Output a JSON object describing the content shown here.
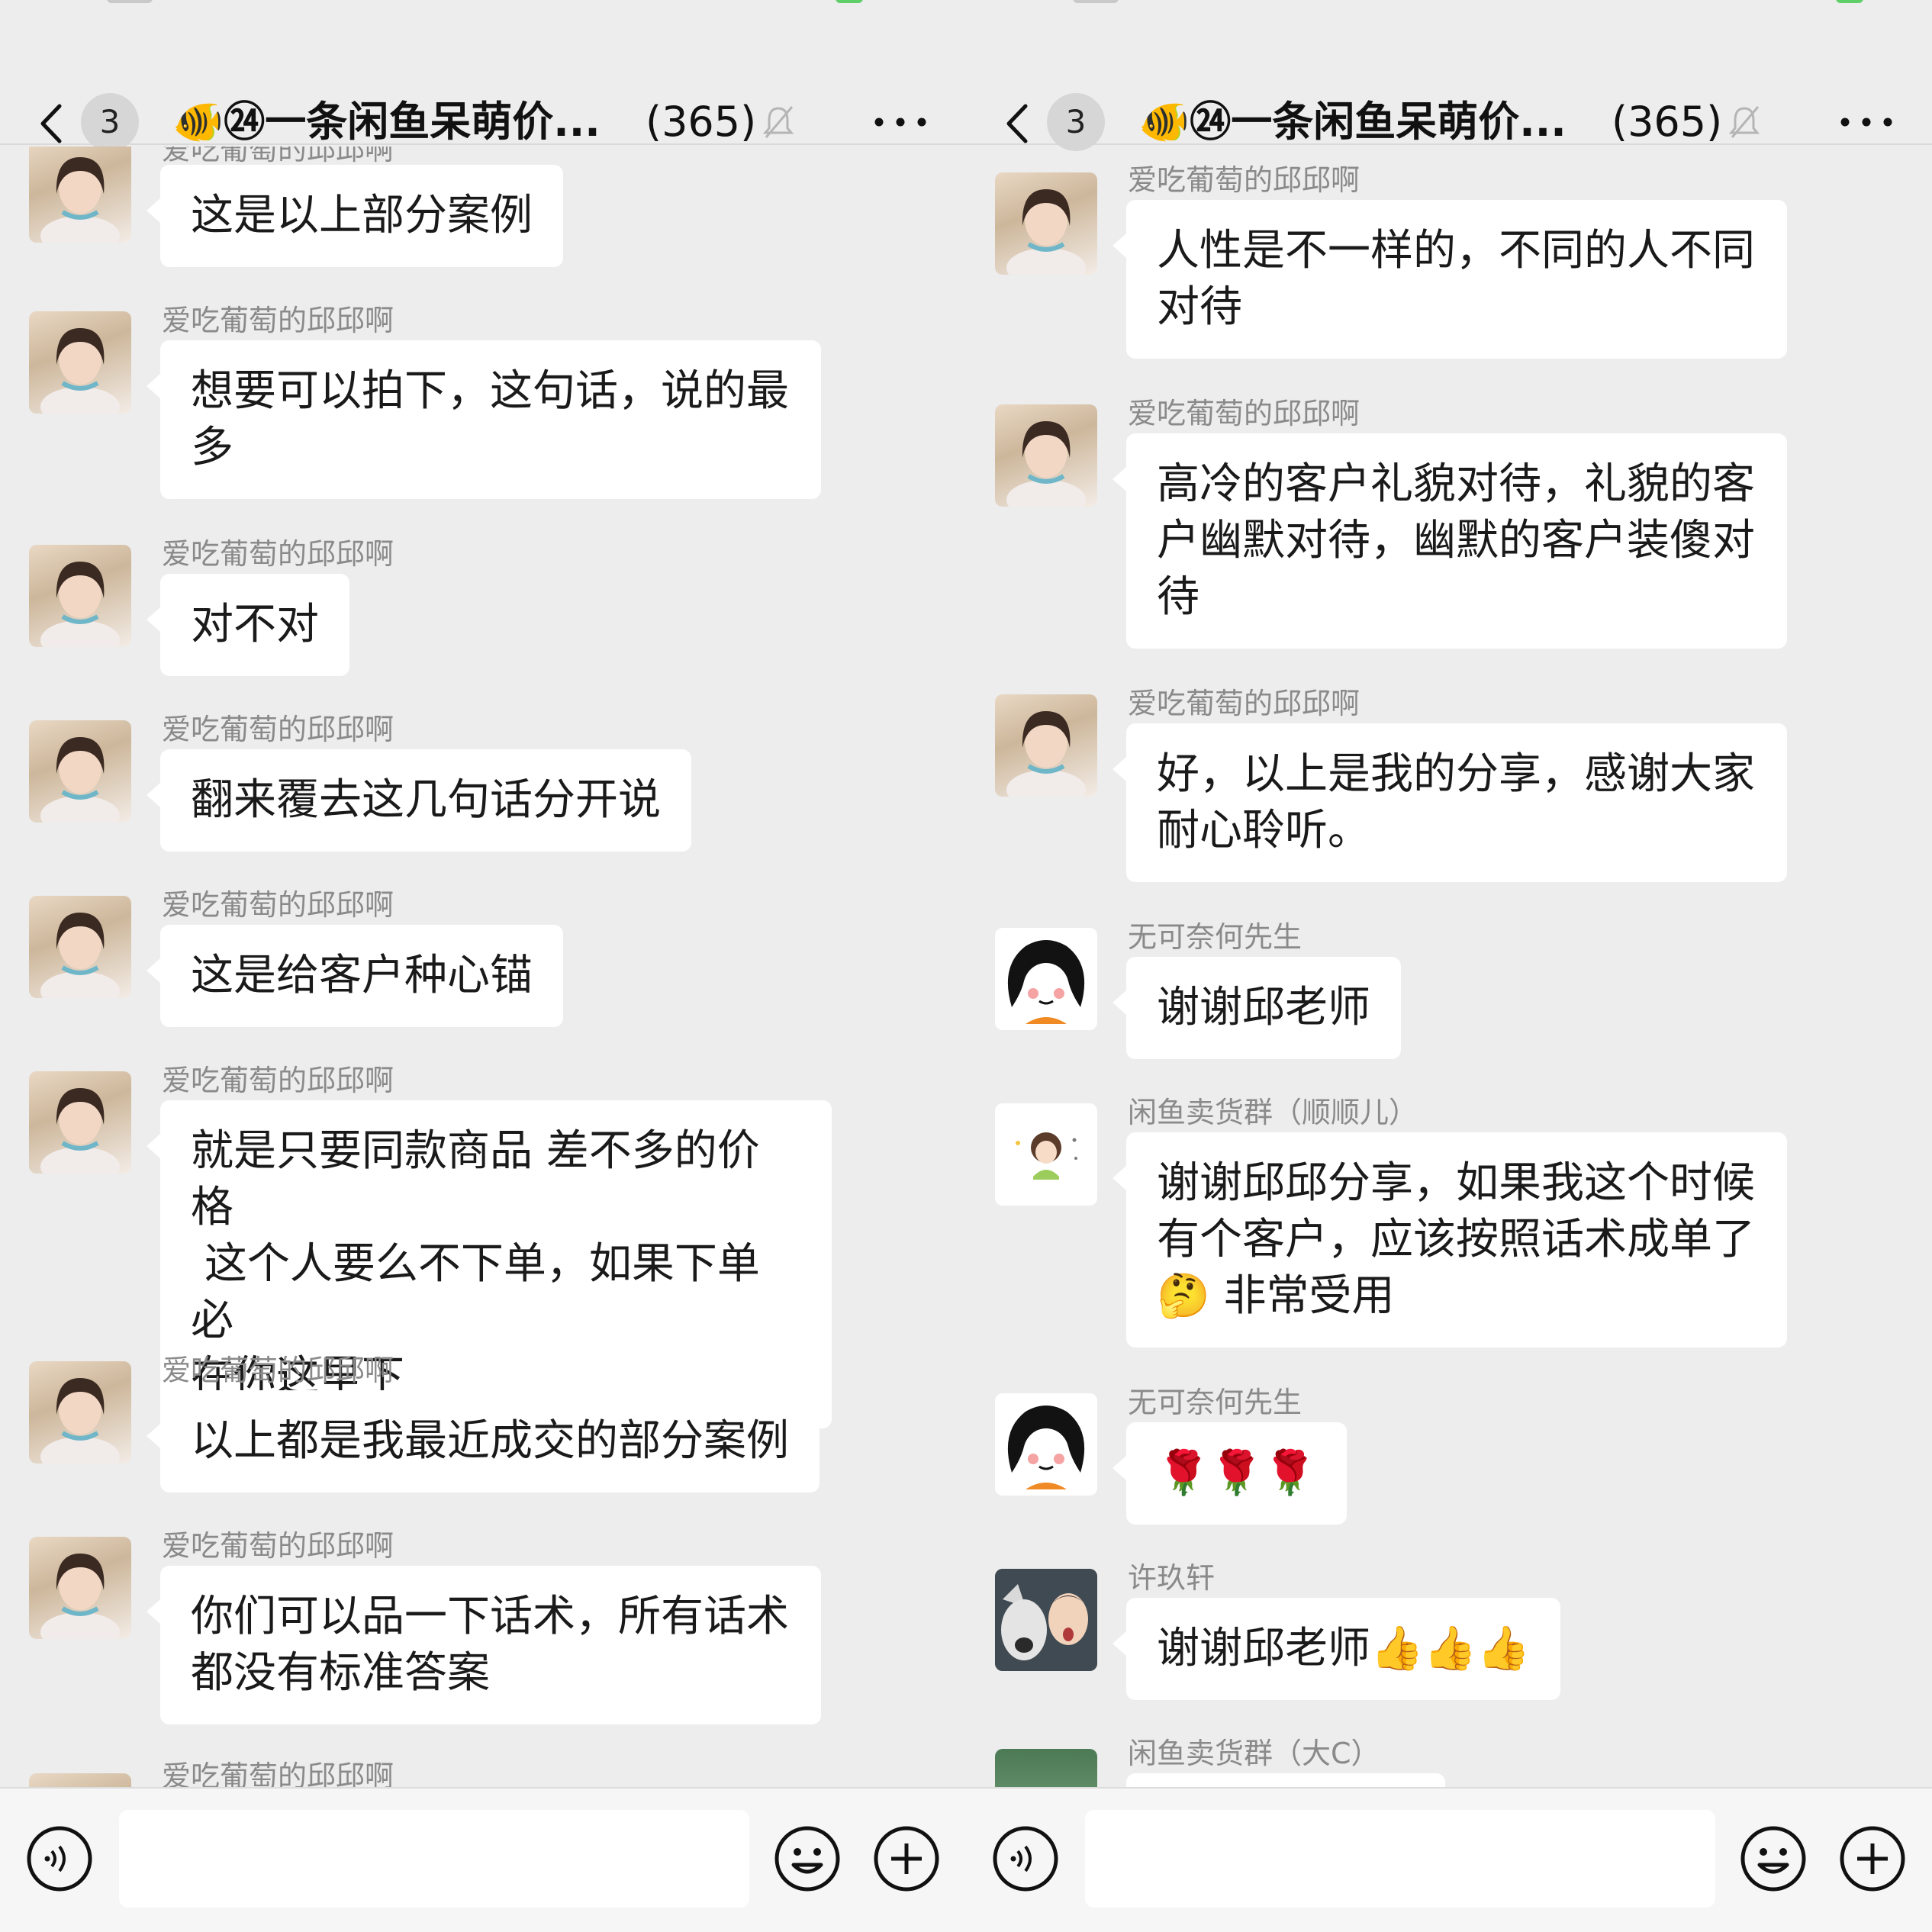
{
  "panels": [
    {
      "header": {
        "back_badge": "3",
        "title": "🐠㉔一条闲鱼呆萌价...",
        "count": "(365)"
      },
      "messages": [
        {
          "sender": "爱吃葡萄的邱邱啊",
          "lines": [
            "这是以上部分案例"
          ],
          "avatar": "avatar-qiuqiu"
        },
        {
          "sender": "爱吃葡萄的邱邱啊",
          "lines": [
            "想要可以拍下，这句话，说的最",
            "多"
          ],
          "avatar": "avatar-qiuqiu"
        },
        {
          "sender": "爱吃葡萄的邱邱啊",
          "lines": [
            "对不对"
          ],
          "avatar": "avatar-qiuqiu"
        },
        {
          "sender": "爱吃葡萄的邱邱啊",
          "lines": [
            "翻来覆去这几句话分开说"
          ],
          "avatar": "avatar-qiuqiu"
        },
        {
          "sender": "爱吃葡萄的邱邱啊",
          "lines": [
            "这是给客户种心锚"
          ],
          "avatar": "avatar-qiuqiu"
        },
        {
          "sender": "爱吃葡萄的邱邱啊",
          "lines": [
            "就是只要同款商品 差不多的价格",
            " 这个人要么不下单，如果下单必",
            "在你这里下"
          ],
          "avatar": "avatar-qiuqiu"
        },
        {
          "sender": "爱吃葡萄的邱邱啊",
          "lines": [
            "以上都是我最近成交的部分案例"
          ],
          "avatar": "avatar-qiuqiu"
        },
        {
          "sender": "爱吃葡萄的邱邱啊",
          "lines": [
            "你们可以品一下话术，所有话术",
            "都没有标准答案"
          ],
          "avatar": "avatar-qiuqiu"
        },
        {
          "sender": "爱吃葡萄的邱邱啊",
          "lines": [],
          "avatar": "avatar-qiuqiu"
        }
      ]
    },
    {
      "header": {
        "back_badge": "3",
        "title": "🐠㉔一条闲鱼呆萌价...",
        "count": "(365)"
      },
      "messages": [
        {
          "sender": "爱吃葡萄的邱邱啊",
          "lines": [
            "人性是不一样的，不同的人不同",
            "对待"
          ],
          "avatar": "avatar-qiuqiu"
        },
        {
          "sender": "爱吃葡萄的邱邱啊",
          "lines": [
            "高冷的客户礼貌对待，礼貌的客",
            "户幽默对待，幽默的客户装傻对",
            "待"
          ],
          "avatar": "avatar-qiuqiu"
        },
        {
          "sender": "爱吃葡萄的邱邱啊",
          "lines": [
            "好，以上是我的分享，感谢大家",
            "耐心聆听。"
          ],
          "avatar": "avatar-qiuqiu"
        },
        {
          "sender": "无可奈何先生",
          "lines": [
            "谢谢邱老师"
          ],
          "avatar": "avatar-cartoon"
        },
        {
          "sender": "闲鱼卖货群（顺顺儿）",
          "lines": [
            "谢谢邱邱分享，如果我这个时候",
            "有个客户，应该按照话术成单了",
            "🤔 非常受用"
          ],
          "avatar": "avatar-small-girl"
        },
        {
          "sender": "无可奈何先生",
          "lines": [
            "🌹🌹🌹"
          ],
          "avatar": "avatar-cartoon"
        },
        {
          "sender": "许玖轩",
          "lines": [
            "谢谢邱老师👍👍👍"
          ],
          "avatar": "avatar-dog"
        },
        {
          "sender": "闲鱼卖货群（大C）",
          "lines": [],
          "avatar": "avatar-scene"
        }
      ]
    }
  ]
}
